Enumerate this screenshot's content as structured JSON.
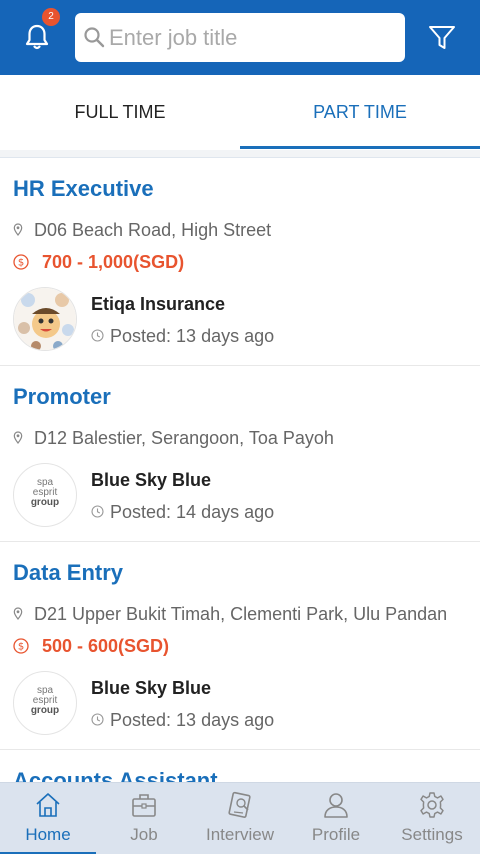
{
  "header": {
    "notification_count": "2",
    "search_placeholder": "Enter job title",
    "colors": {
      "primary": "#1565b8",
      "badge": "#e8542f"
    }
  },
  "tabs": [
    {
      "label": "FULL TIME",
      "active": false
    },
    {
      "label": "PART TIME",
      "active": true
    }
  ],
  "jobs": [
    {
      "title": "HR Executive",
      "location": "D06 Beach Road, High Street",
      "salary": "700 - 1,000(SGD)",
      "company": "Etiqa Insurance",
      "posted": "Posted: 13 days ago",
      "logo": "cartoon-avatar"
    },
    {
      "title": "Promoter",
      "location": "D12 Balestier, Serangoon, Toa Payoh",
      "salary": "",
      "company": "Blue Sky Blue",
      "posted": "Posted: 14 days ago",
      "logo": "spa-esprit-group"
    },
    {
      "title": "Data Entry",
      "location": "D21 Upper Bukit Timah, Clementi Park, Ulu Pandan",
      "salary": "500 - 600(SGD)",
      "company": "Blue Sky Blue",
      "posted": "Posted: 13 days ago",
      "logo": "spa-esprit-group"
    },
    {
      "title": "Accounts Assistant"
    }
  ],
  "logo_text": {
    "spa": "spa",
    "esprit": "esprit",
    "group": "group"
  },
  "nav": [
    {
      "label": "Home",
      "icon": "home-icon",
      "active": true
    },
    {
      "label": "Job",
      "icon": "briefcase-icon",
      "active": false
    },
    {
      "label": "Interview",
      "icon": "interview-icon",
      "active": false
    },
    {
      "label": "Profile",
      "icon": "profile-icon",
      "active": false
    },
    {
      "label": "Settings",
      "icon": "gear-icon",
      "active": false
    }
  ]
}
